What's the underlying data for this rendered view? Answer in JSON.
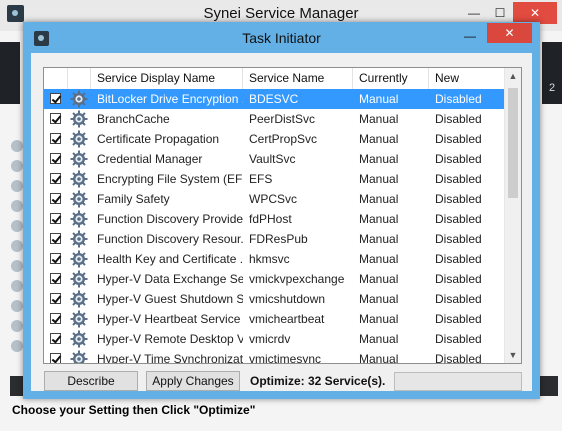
{
  "outer": {
    "title": "Synei Service Manager",
    "controls": {
      "minimize": "—",
      "maximize": "☐",
      "close": "✕"
    },
    "right_strip_text": "2",
    "status": "Choose your Setting then Click \"Optimize\""
  },
  "dialog": {
    "title": "Task Initiator",
    "minimize": "—",
    "close": "✕",
    "columns": [
      "Service Display Name",
      "Service Name",
      "Currently",
      "New"
    ],
    "rows": [
      {
        "display": "BitLocker Drive Encryption ...",
        "service": "BDESVC",
        "current": "Manual",
        "new": "Disabled",
        "checked": true,
        "selected": true
      },
      {
        "display": "BranchCache",
        "service": "PeerDistSvc",
        "current": "Manual",
        "new": "Disabled",
        "checked": true
      },
      {
        "display": "Certificate Propagation",
        "service": "CertPropSvc",
        "current": "Manual",
        "new": "Disabled",
        "checked": true
      },
      {
        "display": "Credential Manager",
        "service": "VaultSvc",
        "current": "Manual",
        "new": "Disabled",
        "checked": true
      },
      {
        "display": "Encrypting File System (EFS)",
        "service": "EFS",
        "current": "Manual",
        "new": "Disabled",
        "checked": true
      },
      {
        "display": "Family Safety",
        "service": "WPCSvc",
        "current": "Manual",
        "new": "Disabled",
        "checked": true
      },
      {
        "display": "Function Discovery Provider...",
        "service": "fdPHost",
        "current": "Manual",
        "new": "Disabled",
        "checked": true
      },
      {
        "display": "Function Discovery Resour...",
        "service": "FDResPub",
        "current": "Manual",
        "new": "Disabled",
        "checked": true
      },
      {
        "display": "Health Key and Certificate ...",
        "service": "hkmsvc",
        "current": "Manual",
        "new": "Disabled",
        "checked": true
      },
      {
        "display": "Hyper-V Data Exchange Se...",
        "service": "vmickvpexchange",
        "current": "Manual",
        "new": "Disabled",
        "checked": true
      },
      {
        "display": "Hyper-V Guest Shutdown S...",
        "service": "vmicshutdown",
        "current": "Manual",
        "new": "Disabled",
        "checked": true
      },
      {
        "display": "Hyper-V Heartbeat Service",
        "service": "vmicheartbeat",
        "current": "Manual",
        "new": "Disabled",
        "checked": true
      },
      {
        "display": "Hyper-V Remote Desktop Vi...",
        "service": "vmicrdv",
        "current": "Manual",
        "new": "Disabled",
        "checked": true
      },
      {
        "display": "Hyper-V Time Synchronizati...",
        "service": "vmictimesync",
        "current": "Manual",
        "new": "Disabled",
        "checked": true
      }
    ],
    "buttons": {
      "describe": "Describe",
      "apply": "Apply Changes"
    },
    "optimize_label": "Optimize: 32 Service(s).",
    "scroll_up": "▲",
    "scroll_down": "▼"
  },
  "colors": {
    "dialog_frame": "#63b0e6",
    "selection": "#3399ff",
    "close": "#d9473d"
  }
}
